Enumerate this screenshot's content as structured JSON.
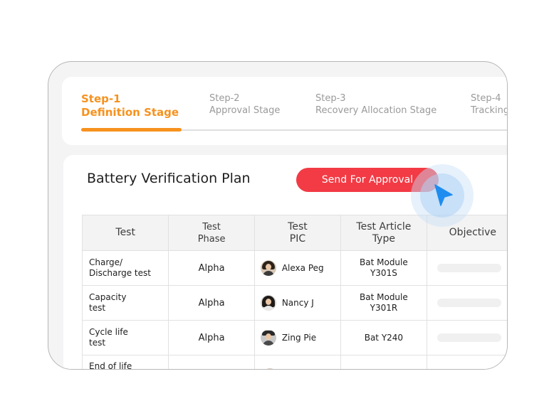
{
  "stepper": {
    "steps": [
      {
        "number": "Step-1",
        "name": "Definition Stage"
      },
      {
        "number": "Step-2",
        "name": "Approval Stage"
      },
      {
        "number": "Step-3",
        "name": "Recovery Allocation Stage"
      },
      {
        "number": "Step-4",
        "name": "Tracking"
      }
    ],
    "active_color": "#f6921e"
  },
  "plan": {
    "title": "Battery Verification Plan",
    "send_button_label": "Send  For Approval",
    "button_color": "#f23b45"
  },
  "table": {
    "headers": [
      "Test",
      "Test\nPhase",
      "Test\nPIC",
      "Test Article\nType",
      "Objective"
    ],
    "rows": [
      {
        "test": "Charge/\nDischarge test",
        "phase": "Alpha",
        "pic": "Alexa Peg",
        "type": "Bat Module\nY301S"
      },
      {
        "test": "Capacity\ntest",
        "phase": "Alpha",
        "pic": "Nancy J",
        "type": "Bat Module\nY301R"
      },
      {
        "test": "Cycle life\ntest",
        "phase": "Alpha",
        "pic": "Zing Pie",
        "type": "Bat Y240"
      },
      {
        "test": "End of life",
        "phase": "",
        "pic": "",
        "type": ""
      }
    ]
  },
  "icons": {
    "cursor": "pointer-cursor-icon",
    "avatar": "user-avatar-icon"
  }
}
